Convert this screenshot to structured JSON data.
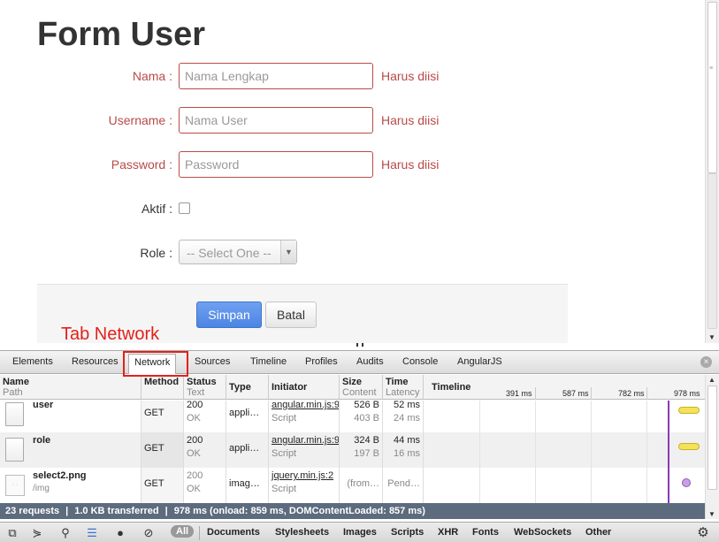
{
  "form": {
    "title": "Form User",
    "fields": {
      "nama": {
        "label": "Nama :",
        "placeholder": "Nama Lengkap",
        "help": "Harus diisi"
      },
      "username": {
        "label": "Username :",
        "placeholder": "Nama User",
        "help": "Harus diisi"
      },
      "password": {
        "label": "Password :",
        "placeholder": "Password",
        "help": "Harus diisi"
      },
      "aktif": {
        "label": "Aktif :"
      },
      "role": {
        "label": "Role :",
        "selected": "-- Select One --"
      }
    },
    "buttons": {
      "save": "Simpan",
      "cancel": "Batal"
    }
  },
  "annotation": {
    "text": "Tab Network",
    "color": "#e3201b"
  },
  "devtools": {
    "tabs": [
      "Elements",
      "Resources",
      "Network",
      "Sources",
      "Timeline",
      "Profiles",
      "Audits",
      "Console",
      "AngularJS"
    ],
    "active_tab": "Network",
    "network": {
      "columns": {
        "name": "Name",
        "path": "Path",
        "method": "Method",
        "status": "Status",
        "status_sub": "Text",
        "type": "Type",
        "initiator": "Initiator",
        "size": "Size",
        "size_sub": "Content",
        "time": "Time",
        "time_sub": "Latency",
        "timeline": "Timeline"
      },
      "timeline_ticks": [
        "391 ms",
        "587 ms",
        "782 ms",
        "978 ms"
      ],
      "rows": [
        {
          "name": "user",
          "path": "",
          "method": "GET",
          "status": "200",
          "status_text": "OK",
          "type": "appli…",
          "initiator": "angular.min.js:9",
          "initiator_type": "Script",
          "size": "526 B",
          "content": "403 B",
          "time": "52 ms",
          "latency": "24 ms"
        },
        {
          "name": "role",
          "path": "",
          "method": "GET",
          "status": "200",
          "status_text": "OK",
          "type": "appli…",
          "initiator": "angular.min.js:9",
          "initiator_type": "Script",
          "size": "324 B",
          "content": "197 B",
          "time": "44 ms",
          "latency": "16 ms"
        },
        {
          "name": "select2.png",
          "path": "/img",
          "method": "GET",
          "status": "200",
          "status_text": "OK",
          "type": "imag…",
          "initiator": "jquery.min.js:2",
          "initiator_type": "Script",
          "size": "(from…",
          "content": "",
          "time": "Pend…",
          "latency": ""
        }
      ],
      "summary": {
        "requests": "23 requests",
        "transferred": "1.0 KB transferred",
        "timing": "978 ms (onload: 859 ms, DOMContentLoaded: 857 ms)"
      },
      "filters": [
        "All",
        "Documents",
        "Stylesheets",
        "Images",
        "Scripts",
        "XHR",
        "Fonts",
        "WebSockets",
        "Other"
      ]
    }
  },
  "colors": {
    "error": "#b94a48",
    "primary_button": "#4c85e3",
    "summary_bar": "#5d6b7e",
    "load_line": "#8a3ab9"
  }
}
